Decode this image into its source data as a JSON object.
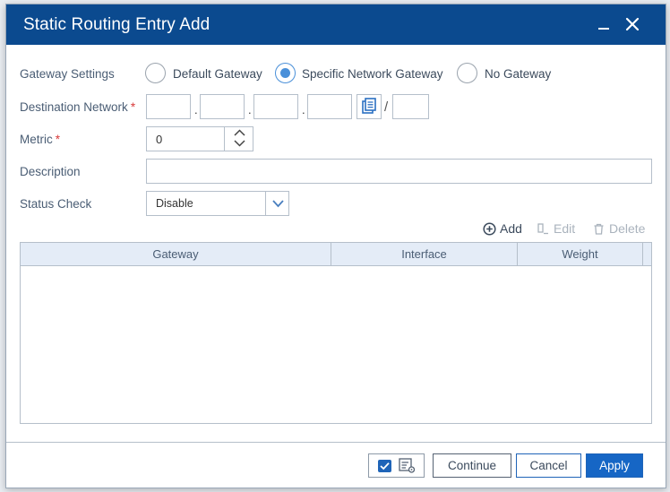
{
  "dialog": {
    "title": "Static Routing Entry Add"
  },
  "gateway_settings": {
    "label": "Gateway Settings",
    "options": [
      {
        "label": "Default Gateway",
        "selected": false
      },
      {
        "label": "Specific Network Gateway",
        "selected": true
      },
      {
        "label": "No Gateway",
        "selected": false
      }
    ]
  },
  "destination_network": {
    "label": "Destination Network",
    "required_mark": "*",
    "octets": [
      "",
      "",
      "",
      ""
    ],
    "separator": ".",
    "mask_separator": "/",
    "mask": ""
  },
  "metric": {
    "label": "Metric",
    "required_mark": "*",
    "value": "0"
  },
  "description": {
    "label": "Description",
    "value": ""
  },
  "status_check": {
    "label": "Status Check",
    "value": "Disable"
  },
  "toolbar": {
    "add": "Add",
    "edit": "Edit",
    "delete": "Delete"
  },
  "table": {
    "columns": [
      "Gateway",
      "Interface",
      "Weight"
    ],
    "rows": []
  },
  "footer": {
    "continue": "Continue",
    "cancel": "Cancel",
    "apply": "Apply"
  },
  "colors": {
    "titlebar": "#0b4a8f",
    "accent": "#1666c5",
    "radio_selected": "#4a90d9"
  }
}
